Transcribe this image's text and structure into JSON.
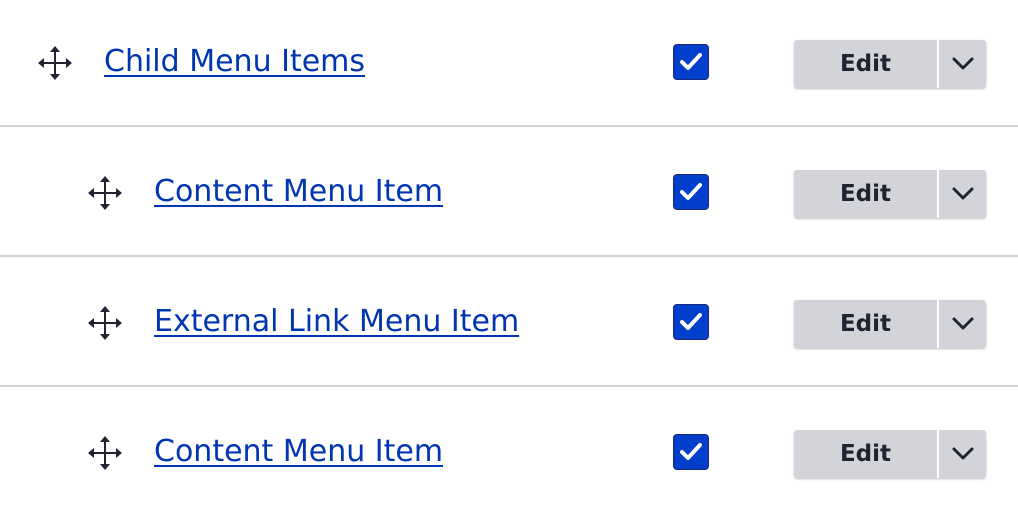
{
  "menu_links": [
    {
      "title": "Child Menu Items",
      "enabled": true,
      "operation": "Edit",
      "depth": 0
    },
    {
      "title": "Content Menu Item",
      "enabled": true,
      "operation": "Edit",
      "depth": 1
    },
    {
      "title": "External Link Menu Item",
      "enabled": true,
      "operation": "Edit",
      "depth": 1
    },
    {
      "title": "Content Menu Item",
      "enabled": true,
      "operation": "Edit",
      "depth": 1
    }
  ],
  "icons": {
    "drag": "move-arrows-icon",
    "check": "checkmark-icon",
    "toggle": "chevron-down-icon"
  },
  "colors": {
    "link": "#0036b1",
    "checkbox": "#003ecc",
    "button_bg": "#d3d4d9",
    "button_text": "#222330",
    "row_divider": "#d3d4d9"
  }
}
